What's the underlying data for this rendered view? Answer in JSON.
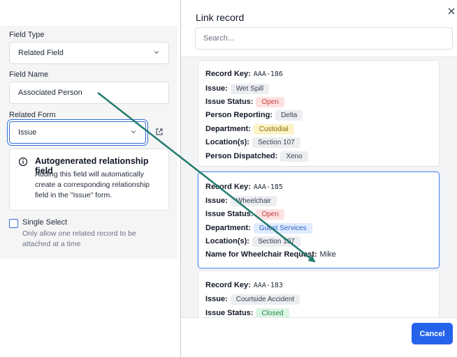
{
  "form": {
    "field_type_label": "Field Type",
    "field_type_value": "Related Field",
    "field_name_label": "Field Name",
    "field_name_value": "Associated Person",
    "related_form_label": "Related Form",
    "related_form_value": "Issue",
    "info_title": "Autogenerated relationship field",
    "info_text": "Adding this field will automatically create a corresponding relationship field in the \"Issue\" form.",
    "single_select_label": "Single Select",
    "single_select_help": "Only allow one related record to be attached at a time",
    "single_select_checked": false
  },
  "dialog": {
    "title": "Link record",
    "search_placeholder": "Search...",
    "cancel_label": "Cancel",
    "records": [
      {
        "fields": [
          {
            "key": "Record Key:",
            "value": "AAA-186",
            "style": "mono"
          },
          {
            "key": "Issue:",
            "value": "Wet Spill",
            "style": "gray"
          },
          {
            "key": "Issue Status:",
            "value": "Open",
            "style": "red"
          },
          {
            "key": "Person Reporting:",
            "value": "Delta",
            "style": "gray"
          },
          {
            "key": "Department:",
            "value": "Custodial",
            "style": "yellow"
          },
          {
            "key": "Location(s):",
            "value": "Section 107",
            "style": "gray"
          },
          {
            "key": "Person Dispatched:",
            "value": "Xeno",
            "style": "gray"
          }
        ]
      },
      {
        "fields": [
          {
            "key": "Record Key:",
            "value": "AAA-185",
            "style": "mono"
          },
          {
            "key": "Issue:",
            "value": "Wheelchair",
            "style": "gray"
          },
          {
            "key": "Issue Status:",
            "value": "Open",
            "style": "red"
          },
          {
            "key": "Department:",
            "value": "Guest Services",
            "style": "blue"
          },
          {
            "key": "Location(s):",
            "value": "Section 107",
            "style": "gray"
          },
          {
            "key": "Name for Wheelchair Request:",
            "value": "Mike",
            "style": "text"
          }
        ]
      },
      {
        "fields": [
          {
            "key": "Record Key:",
            "value": "AAA-183",
            "style": "mono"
          },
          {
            "key": "Issue:",
            "value": "Courtside Accident",
            "style": "gray"
          },
          {
            "key": "Issue Status:",
            "value": "Closed",
            "style": "green"
          }
        ]
      }
    ]
  },
  "colors": {
    "accent": "#2563eb",
    "annotation_arrow": "#217a6d"
  }
}
